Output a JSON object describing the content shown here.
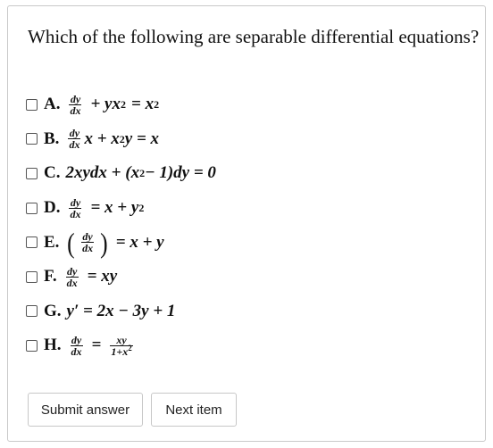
{
  "question": "Which of the following are separable differential equations?",
  "options": [
    {
      "letter": "A.",
      "checked": false
    },
    {
      "letter": "B.",
      "checked": false
    },
    {
      "letter": "C.",
      "checked": false
    },
    {
      "letter": "D.",
      "checked": false
    },
    {
      "letter": "E.",
      "checked": false
    },
    {
      "letter": "F.",
      "checked": false
    },
    {
      "letter": "G.",
      "checked": false
    },
    {
      "letter": "H.",
      "checked": false
    }
  ],
  "equations": {
    "a": {
      "dy": "dy",
      "dx": "dx",
      "rest": "+ yx",
      "sq": "2",
      "eq": "= x",
      "sq2": "2"
    },
    "b": {
      "dy": "dy",
      "dx": "dx",
      "rest": "x + x",
      "sq": "2",
      "tail": "y = x"
    },
    "c": {
      "text1": "2xydx + (x",
      "sq": "2",
      "text2": " − 1)dy = 0"
    },
    "d": {
      "dy": "dy",
      "dx": "dx",
      "rest": "= x + y",
      "sq": "2"
    },
    "e": {
      "dy": "dy",
      "dx": "dx",
      "lp": "(",
      "rp": ")",
      "rest": "= x + y"
    },
    "f": {
      "dy": "dy",
      "dx": "dx",
      "rest": "= xy"
    },
    "g": {
      "text": "y′ = 2x − 3y + 1"
    },
    "h": {
      "dy": "dy",
      "dx": "dx",
      "eq": "=",
      "num": "xy",
      "den": "1+x",
      "sq": "2"
    }
  },
  "buttons": {
    "submit": "Submit answer",
    "next": "Next item"
  }
}
